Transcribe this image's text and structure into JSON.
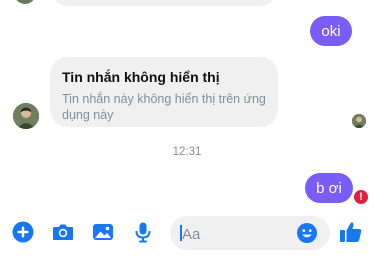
{
  "messages": {
    "sent_1": "oki",
    "unsupported_title": "Tin nhắn không hiển thị",
    "unsupported_body": "Tin nhắn này không hiển thị trên ứng dụng này",
    "timestamp": "12:31",
    "sent_2": "b ơi",
    "error_mark": "!"
  },
  "composer": {
    "placeholder": "Aa"
  },
  "colors": {
    "accent": "#1877f2",
    "bubble_me": "#7a5cf6",
    "bubble_other": "#f0f0f0",
    "error": "#e41e3f"
  },
  "icons": [
    "add-circle-icon",
    "camera-icon",
    "image-icon",
    "microphone-icon",
    "emoji-icon",
    "thumbs-up-icon"
  ]
}
